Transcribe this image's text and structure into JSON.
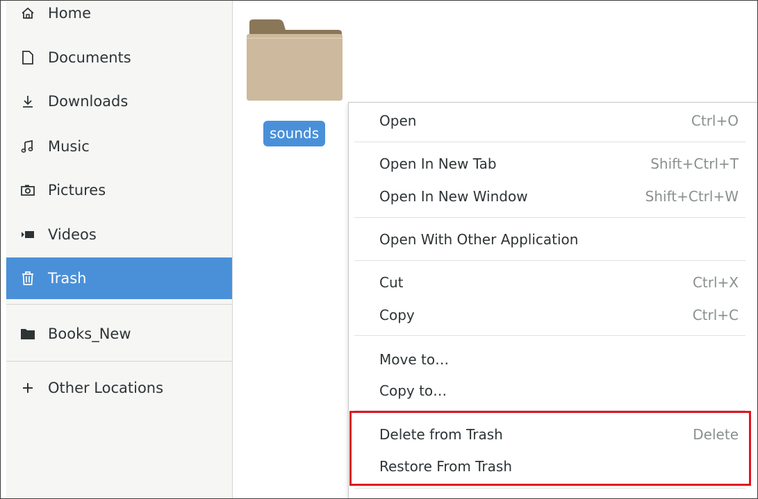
{
  "sidebar": {
    "items": [
      {
        "label": "Home",
        "icon": "home-icon"
      },
      {
        "label": "Documents",
        "icon": "document-icon"
      },
      {
        "label": "Downloads",
        "icon": "download-icon"
      },
      {
        "label": "Music",
        "icon": "music-icon"
      },
      {
        "label": "Pictures",
        "icon": "camera-icon"
      },
      {
        "label": "Videos",
        "icon": "video-icon"
      },
      {
        "label": "Trash",
        "icon": "trash-icon",
        "active": true
      }
    ],
    "bookmarks": [
      {
        "label": "Books_New",
        "icon": "folder-icon"
      }
    ],
    "other_locations": {
      "label": "Other Locations",
      "icon": "plus-icon"
    }
  },
  "content": {
    "folder": {
      "name": "sounds",
      "icon": "folder-icon"
    }
  },
  "context_menu": {
    "items": [
      {
        "label": "Open",
        "accel": "Ctrl+O"
      },
      {
        "label": "Open In New Tab",
        "accel": "Shift+Ctrl+T"
      },
      {
        "label": "Open In New Window",
        "accel": "Shift+Ctrl+W"
      },
      {
        "label": "Open With Other Application",
        "accel": ""
      },
      {
        "label": "Cut",
        "accel": "Ctrl+X"
      },
      {
        "label": "Copy",
        "accel": "Ctrl+C"
      },
      {
        "label": "Move to…",
        "accel": ""
      },
      {
        "label": "Copy to…",
        "accel": ""
      },
      {
        "label": "Delete from Trash",
        "accel": "Delete"
      },
      {
        "label": "Restore From Trash",
        "accel": ""
      }
    ]
  },
  "colors": {
    "accent": "#4a90d9",
    "highlight_box": "#e1141f",
    "folder": "#cdb99d"
  }
}
